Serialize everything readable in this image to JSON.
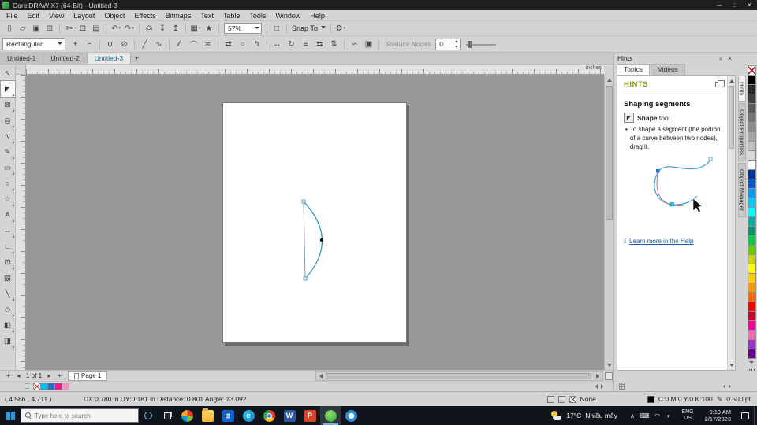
{
  "window": {
    "title": "CorelDRAW X7 (64-Bit) - Untitled-3",
    "controls": [
      {
        "name": "minimize-button",
        "glyph": "─"
      },
      {
        "name": "maximize-button",
        "glyph": "□"
      },
      {
        "name": "close-button",
        "glyph": "✕"
      }
    ]
  },
  "menubar": {
    "items": [
      "File",
      "Edit",
      "View",
      "Layout",
      "Object",
      "Effects",
      "Bitmaps",
      "Text",
      "Table",
      "Tools",
      "Window",
      "Help"
    ]
  },
  "std_toolbar": {
    "arrow_glyph": "▾",
    "zoom_level": "57%",
    "snap_to_label": "Snap To",
    "icons_a": [
      {
        "name": "new-document-icon",
        "glyph": "▯"
      },
      {
        "name": "open-icon",
        "glyph": "▱"
      },
      {
        "name": "save-icon",
        "glyph": "▣"
      },
      {
        "name": "print-icon",
        "glyph": "⊟"
      },
      {
        "sep": true
      },
      {
        "name": "cut-icon",
        "glyph": "✂"
      },
      {
        "name": "copy-icon",
        "glyph": "⊡"
      },
      {
        "name": "paste-icon",
        "glyph": "▤"
      },
      {
        "sep": true
      },
      {
        "name": "undo-icon",
        "glyph": "↶",
        "arrow": true
      },
      {
        "name": "redo-icon",
        "glyph": "↷",
        "arrow": true
      },
      {
        "sep": true
      },
      {
        "name": "search-content-icon",
        "glyph": "◎"
      },
      {
        "name": "import-icon",
        "glyph": "↧"
      },
      {
        "name": "export-icon",
        "glyph": "↥"
      },
      {
        "sep": true
      },
      {
        "name": "application-launcher-icon",
        "glyph": "▦",
        "arrow": true
      },
      {
        "name": "welcome-screen-icon",
        "glyph": "★"
      },
      {
        "sep": true
      }
    ],
    "icons_b": [
      {
        "sep": true
      },
      {
        "name": "fullscreen-preview-icon",
        "glyph": "□"
      },
      {
        "sep": true
      }
    ],
    "icons_c": [
      {
        "sep": true
      },
      {
        "name": "options-icon",
        "glyph": "⚙",
        "arrow": true
      }
    ]
  },
  "property_bar": {
    "selection_mode": "Rectangular",
    "reduce_nodes_label": "Reduce Nodes",
    "curve_smoothness_value": "0",
    "icons": [
      {
        "name": "add-node-icon",
        "glyph": "+"
      },
      {
        "name": "delete-node-icon",
        "glyph": "−"
      },
      {
        "sep": true
      },
      {
        "name": "join-nodes-icon",
        "glyph": "∪"
      },
      {
        "name": "break-curve-icon",
        "glyph": "⊘"
      },
      {
        "sep": true
      },
      {
        "name": "convert-to-line-icon",
        "glyph": "╱"
      },
      {
        "name": "convert-to-curve-icon",
        "glyph": "∿"
      },
      {
        "sep": true
      },
      {
        "name": "cusp-node-icon",
        "glyph": "∠"
      },
      {
        "name": "smooth-node-icon",
        "glyph": "⌒"
      },
      {
        "name": "symmetrical-node-icon",
        "glyph": "≍"
      },
      {
        "sep": true
      },
      {
        "name": "reverse-direction-icon",
        "glyph": "⇄"
      },
      {
        "name": "close-curve-icon",
        "glyph": "○"
      },
      {
        "name": "extract-subpath-icon",
        "glyph": "↰"
      },
      {
        "sep": true
      },
      {
        "name": "stretch-nodes-icon",
        "glyph": "↔"
      },
      {
        "name": "rotate-nodes-icon",
        "glyph": "↻"
      },
      {
        "name": "align-nodes-icon",
        "glyph": "≡"
      },
      {
        "name": "reflect-horizontal-icon",
        "glyph": "⇆"
      },
      {
        "name": "reflect-vertical-icon",
        "glyph": "⇅"
      },
      {
        "sep": true
      },
      {
        "name": "elastic-mode-icon",
        "glyph": "∽"
      },
      {
        "name": "select-all-nodes-icon",
        "glyph": "▣"
      },
      {
        "sep": true
      }
    ]
  },
  "document_tabs": {
    "tabs": [
      {
        "label": "Untitled-1",
        "active": false
      },
      {
        "label": "Untitled-2",
        "active": false
      },
      {
        "label": "Untitled-3",
        "active": true
      }
    ],
    "new_tab_glyph": "+"
  },
  "toolbox": {
    "tools": [
      {
        "name": "pick-tool",
        "glyph": "↖"
      },
      {
        "name": "shape-tool",
        "glyph": "◤",
        "active": true,
        "flyout": true
      },
      {
        "name": "crop-tool",
        "glyph": "⊠",
        "flyout": true
      },
      {
        "name": "zoom-tool",
        "glyph": "◎",
        "flyout": true
      },
      {
        "name": "freehand-tool",
        "glyph": "∿",
        "flyout": true
      },
      {
        "name": "artistic-media-tool",
        "glyph": "✎",
        "flyout": true
      },
      {
        "name": "rectangle-tool",
        "glyph": "▭",
        "flyout": true
      },
      {
        "name": "ellipse-tool",
        "glyph": "○",
        "flyout": true
      },
      {
        "name": "polygon-tool",
        "glyph": "☆",
        "flyout": true
      },
      {
        "name": "text-tool",
        "glyph": "A",
        "flyout": true
      },
      {
        "name": "parallel-dimension-tool",
        "glyph": "↔",
        "flyout": true
      },
      {
        "name": "straight-line-connector-tool",
        "glyph": "∟",
        "flyout": true
      },
      {
        "name": "drop-shadow-tool",
        "glyph": "⊡",
        "flyout": true
      },
      {
        "name": "transparency-tool",
        "glyph": "▨"
      },
      {
        "name": "color-eyedropper-tool",
        "glyph": "╲",
        "flyout": true
      },
      {
        "name": "outline-pen-tool",
        "glyph": "◇",
        "flyout": true
      },
      {
        "name": "edit-fill-tool",
        "glyph": "◧",
        "flyout": true
      },
      {
        "name": "interactive-fill-tool",
        "glyph": "◨",
        "flyout": true
      }
    ]
  },
  "rulers": {
    "units": "inches"
  },
  "hints_docker": {
    "title": "Hints",
    "collapse_glyph": "»",
    "close_glyph": "✕",
    "tabs": [
      {
        "label": "Topics",
        "active": true
      },
      {
        "label": "Videos",
        "active": false
      }
    ],
    "heading": "HINTS",
    "section_title": "Shaping segments",
    "tool_icon_glyph": "◤",
    "tool_label_bold": "Shape",
    "tool_label_rest": " tool",
    "bullet_glyph": "•",
    "bullet_text": "To shape a segment (the portion of a curve between two nodes), drag it.",
    "learn_more_icon_glyph": "ℹ",
    "learn_more_label": "Learn more in the Help"
  },
  "docker_tabs": {
    "tabs": [
      {
        "label": "Hints",
        "active": true
      },
      {
        "label": "Object Properties",
        "active": false
      },
      {
        "label": "Object Manager",
        "active": false
      }
    ]
  },
  "color_palette": {
    "colors": [
      "#000000",
      "#262626",
      "#404040",
      "#595959",
      "#737373",
      "#8c8c8c",
      "#a6a6a6",
      "#bfbfbf",
      "#d9d9d9",
      "#ffffff",
      "#003399",
      "#0055d4",
      "#0099ff",
      "#00ccff",
      "#00ffff",
      "#00b3a1",
      "#009966",
      "#00cc44",
      "#66cc00",
      "#c8d400",
      "#ffff00",
      "#ffcc00",
      "#ff9900",
      "#ff6600",
      "#ff0000",
      "#cc0033",
      "#ff0099",
      "#ff66b3",
      "#9933cc",
      "#660099"
    ]
  },
  "document_palette": {
    "colors": [
      "#00bdf2",
      "#1e73c8",
      "#ec1a8d",
      "#f692bd"
    ]
  },
  "page_nav": {
    "add_page_glyph": "+",
    "prev_glyph": "◂",
    "next_glyph": "▸",
    "page_indicator": "1 of 1",
    "page_tab_label": "Page 1"
  },
  "status_bar": {
    "cursor_position": "( 4.586 , 4.711 )",
    "transform_info": "DX:0.780 in DY:0.181 in Distance: 0.801 Angle: 13.092",
    "fill_label": "None",
    "outline_color": "C:0 M:0 Y:0 K:100",
    "pen_glyph": "✎",
    "outline_width": "0.500 pt"
  },
  "taskbar": {
    "search_placeholder": "Type here to search",
    "apps": [
      {
        "name": "coreldraw-suite",
        "cls": "ico-cdrsuite",
        "glyph": ""
      },
      {
        "name": "file-explorer",
        "cls": "ico-folder",
        "glyph": ""
      },
      {
        "name": "microsoft-store",
        "cls": "ico-store",
        "glyph": "⊞"
      },
      {
        "name": "edge",
        "cls": "ico-edge",
        "glyph": "e"
      },
      {
        "name": "chrome",
        "cls": "ico-chrome",
        "glyph": ""
      },
      {
        "name": "word",
        "cls": "ico-word",
        "glyph": "W"
      },
      {
        "name": "powerpoint",
        "cls": "ico-ppt",
        "glyph": "P"
      },
      {
        "name": "coreldraw-x7",
        "cls": "ico-cdr",
        "glyph": "",
        "active": true
      },
      {
        "name": "safari",
        "cls": "ico-safari",
        "glyph": ""
      }
    ],
    "weather_temp": "17°C",
    "weather_desc": "Nhiều mây",
    "tray": [
      {
        "name": "hidden-icons-chevron",
        "glyph": "∧"
      },
      {
        "name": "keyboard-icon",
        "glyph": "⌨"
      },
      {
        "name": "network-icon",
        "glyph": "◠"
      },
      {
        "name": "volume-icon",
        "glyph": "◖"
      }
    ],
    "language_line1": "ENG",
    "language_line2": "US",
    "time": "9:19 AM",
    "date": "2/17/2023"
  }
}
